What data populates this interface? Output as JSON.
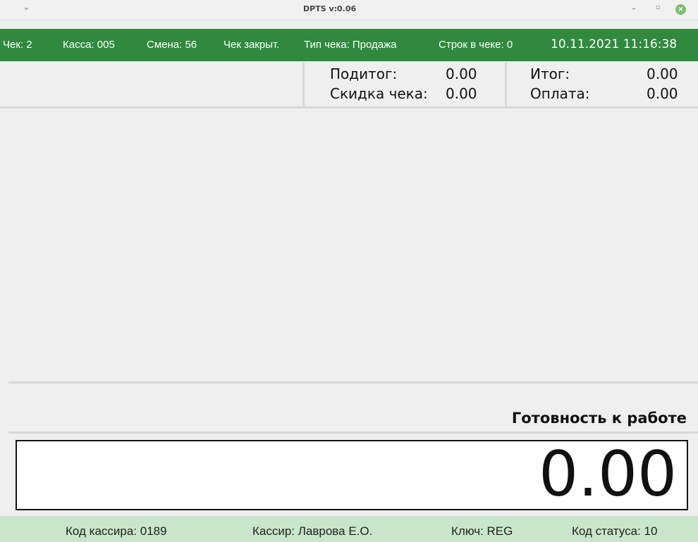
{
  "window": {
    "title": "DPTS v:0.06",
    "menu_icon": "chevron-down-icon",
    "controls": {
      "minimize": "–",
      "restore": "▫",
      "close": "×"
    }
  },
  "infobar": {
    "check": "Чек: 2",
    "register": "Касса: 005",
    "shift": "Смена:  56",
    "check_state": "Чек  закрыт.",
    "check_type": "Тип чека: Продажа",
    "rows": "Строк в чеке:  0",
    "datetime": "10.11.2021 11:16:38"
  },
  "totals": {
    "subtotal_label": "Подитог:",
    "subtotal_value": "0.00",
    "discount_label": "Скидка чека:",
    "discount_value": "0.00",
    "total_label": "Итог:",
    "total_value": "0.00",
    "payment_label": "Оплата:",
    "payment_value": "0.00"
  },
  "status": {
    "message": "Готовность к работе"
  },
  "display": {
    "value": "0.00"
  },
  "bottombar": {
    "cashier_code": "Код кассира: 0189",
    "cashier": "Кассир: Лаврова Е.О.",
    "key": "Ключ: REG",
    "status_code": "Код статуса: 10"
  },
  "colors": {
    "infobar": "#2f8a3d",
    "bottombar": "#c8e6c9",
    "close_button": "#7cbf6c"
  }
}
